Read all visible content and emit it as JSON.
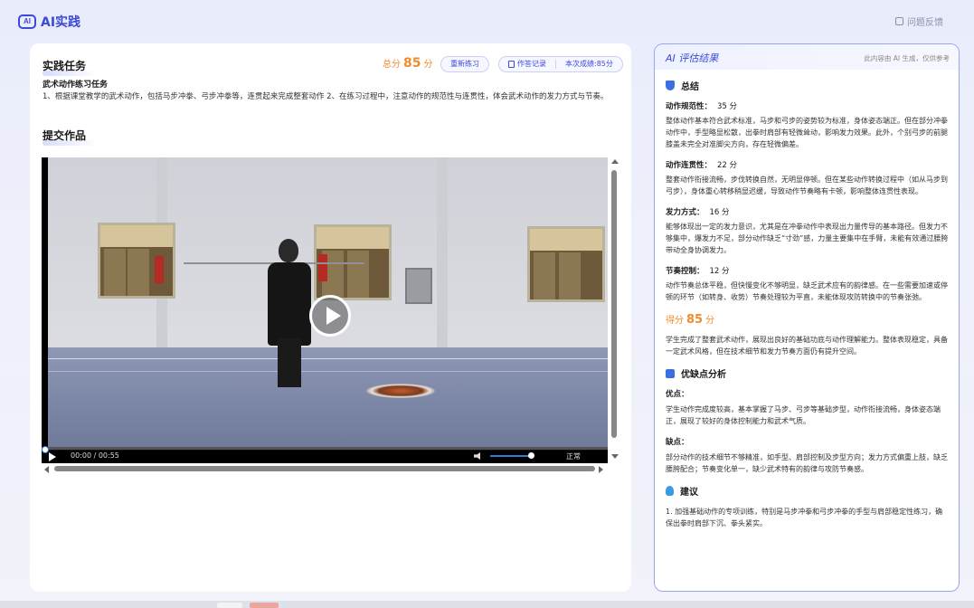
{
  "app": {
    "title": "AI实践",
    "logo_badge": "AI",
    "feedback": "问题反馈"
  },
  "task": {
    "section_title": "实践任务",
    "total_label": "总分",
    "total_score": "85",
    "total_unit": "分",
    "retry_button": "重新练习",
    "record_button": "作答记录",
    "current_score": "本次成绩:85分",
    "name": "武术动作练习任务",
    "description": "1、根据课堂教学的武术动作，包括马步冲拳、弓步冲拳等，连贯起来完成整套动作 2、在练习过程中，注意动作的规范性与连贯性，体会武术动作的发力方式与节奏。"
  },
  "submission": {
    "section_title": "提交作品",
    "video": {
      "time": "00:00 / 00:55",
      "quality": "正常",
      "progress": 0.0,
      "volume": 0.9
    }
  },
  "evaluation": {
    "title": "AI 评估结果",
    "note": "此内容由 AI 生成，仅供参考",
    "summary_title": "总结",
    "items": [
      {
        "label": "动作规范性：",
        "score": "35 分",
        "text": "整体动作基本符合武术标准，马步和弓步的姿势较为标准，身体姿态端正。但在部分冲拳动作中，手型略显松散，出拳时肩部有轻微耸动，影响发力效果。此外，个别弓步的前腿膝盖未完全对准脚尖方向，存在轻微偏差。"
      },
      {
        "label": "动作连贯性：",
        "score": "22 分",
        "text": "整套动作衔接流畅，步伐转换自然，无明显停顿。但在某些动作转换过程中（如从马步到弓步），身体重心转移稍显迟缓，导致动作节奏略有卡顿，影响整体连贯性表现。"
      },
      {
        "label": "发力方式：",
        "score": "16 分",
        "text": "能够体现出一定的发力意识，尤其是在冲拳动作中表现出力量传导的基本路径。但发力不够集中，爆发力不足，部分动作缺乏“寸劲”感，力量主要集中在手臂，未能有效通过腰胯带动全身协调发力。"
      },
      {
        "label": "节奏控制：",
        "score": "12 分",
        "text": "动作节奏总体平稳，但快慢变化不够明显，缺乏武术应有的韵律感。在一些需要加速或停顿的环节（如转身、收势）节奏处理较为平直，未能体现攻防转换中的节奏张弛。"
      }
    ],
    "score_label": "得分",
    "score_value": "85",
    "score_unit": "分",
    "score_comment": "学生完成了整套武术动作，展现出良好的基础功底与动作理解能力。整体表现稳定，具备一定武术风格，但在技术细节和发力节奏方面仍有提升空间。",
    "analysis_title": "优缺点分析",
    "pros_label": "优点：",
    "pros_text": "学生动作完成度较高，基本掌握了马步、弓步等基础步型，动作衔接流畅，身体姿态端正，展现了较好的身体控制能力和武术气质。",
    "cons_label": "缺点：",
    "cons_text": "部分动作的技术细节不够精准，如手型、肩部控制及步型方向；发力方式偏重上肢，缺乏腰胯配合；节奏变化单一，缺少武术特有的韵律与攻防节奏感。",
    "advice_title": "建议",
    "advice_text": "1. 加强基础动作的专项训练，特别是马步冲拳和弓步冲拳的手型与肩部稳定性练习，确保出拳时肩部下沉、拳头紧实。"
  },
  "colors": {
    "accent": "#3b4ad9",
    "score": "#f08c2e",
    "panel_border": "#9aa7f0"
  }
}
